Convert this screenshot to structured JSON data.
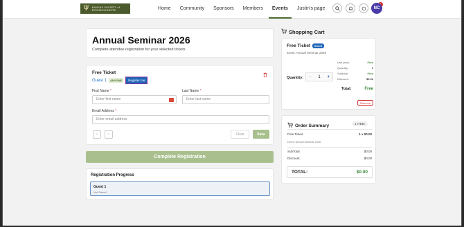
{
  "nav": {
    "logo_text": "KANSAS SOCIETY of PSYCHOLOGISTS",
    "logo_symbol": "Ψ",
    "links": [
      "Home",
      "Community",
      "Sponsors",
      "Members",
      "Events",
      "Justin's page"
    ],
    "active_link": "Events",
    "cart_count": "1",
    "avatar_initials": "NC",
    "icons": [
      "search-icon",
      "bell-icon",
      "chat-icon",
      "cart-icon"
    ]
  },
  "seminar": {
    "title": "Annual Seminar 2026",
    "subtitle": "Complete attendee registration for your selected tickets"
  },
  "ticket": {
    "title": "Free Ticket",
    "guest_label": "Guest 1",
    "anyone_badge": "ANYONE",
    "register_me": "Register me",
    "first_name_label": "First Name",
    "first_name_placeholder": "Enter first name",
    "last_name_label": "Last Name",
    "last_name_placeholder": "Enter last name",
    "email_label": "Email Address",
    "email_placeholder": "Enter email address",
    "required_mark": "*",
    "prev_label": "‹",
    "next_label": "›",
    "clear_label": "Clear",
    "save_label": "Save"
  },
  "complete_label": "Complete Registration",
  "progress": {
    "title": "Registration Progress",
    "guest": "Guest 1",
    "status": "Not Saved"
  },
  "cart": {
    "heading": "Shopping Cart",
    "item_title": "Free Ticket",
    "item_badge": "Event",
    "item_sub": "Event: Annual Seminar 2026",
    "unit_price_label": "Unit price:",
    "unit_price": "Free",
    "quantity_label": "Quantity:",
    "quantity": "1",
    "subtotal_label": "Subtotal:",
    "subtotal": "Free",
    "discount_label": "Discount:",
    "discount": "$0.00",
    "qty_label": "Quantity:",
    "qty_value": "1",
    "minus": "−",
    "plus": "+",
    "total_label": "Total:",
    "total": "Free",
    "remove_label": "Remove"
  },
  "summary": {
    "heading": "Order Summary",
    "items_badge": "1 ITEM",
    "item_name": "Free Ticket",
    "item_qty_price": "1 x $0.00",
    "item_sub": "Event: Annual Seminar 2026",
    "subtotal_label": "SubTotal:",
    "subtotal": "$0.00",
    "discount_label": "Discount:",
    "discount": "$0.00",
    "total_label": "TOTAL:",
    "total": "$0.00"
  }
}
